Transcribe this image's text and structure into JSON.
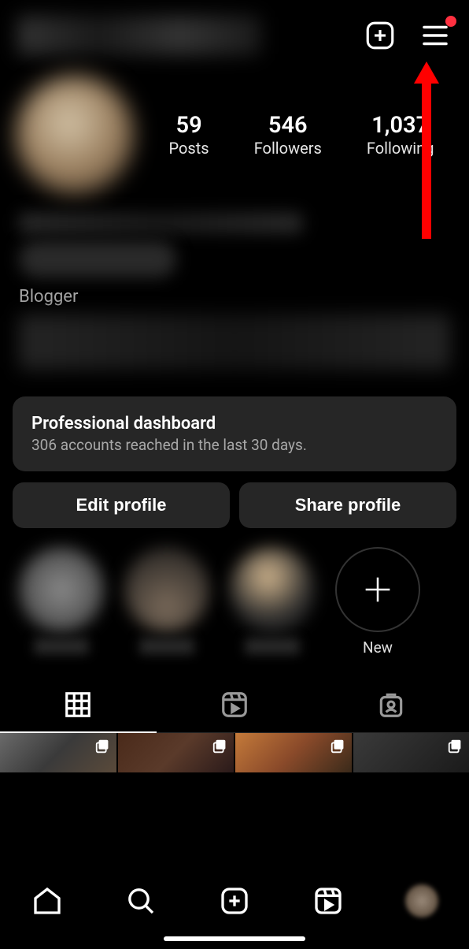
{
  "stats": {
    "posts": {
      "count": "59",
      "label": "Posts"
    },
    "followers": {
      "count": "546",
      "label": "Followers"
    },
    "following": {
      "count": "1,037",
      "label": "Following"
    }
  },
  "bio": {
    "category": "Blogger"
  },
  "dashboard": {
    "title": "Professional dashboard",
    "subtitle": "306 accounts reached in the last 30 days."
  },
  "actions": {
    "edit": "Edit profile",
    "share": "Share profile"
  },
  "highlights": {
    "new_label": "New"
  }
}
